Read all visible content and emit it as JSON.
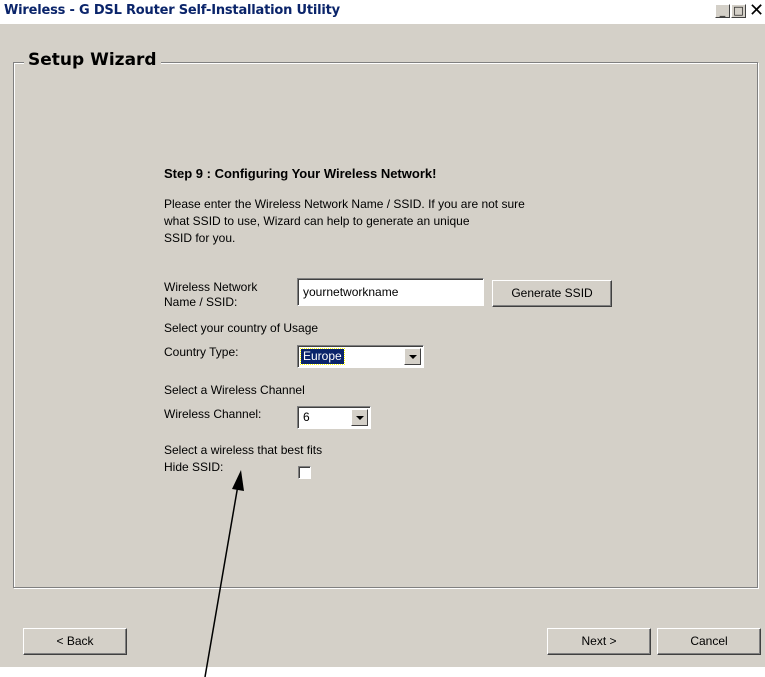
{
  "window": {
    "title": "Wireless - G DSL Router Self-Installation Utility",
    "minimize_glyph": "_",
    "maximize_glyph": "□",
    "close_glyph": "✕"
  },
  "wizard": {
    "group_title": "Setup Wizard",
    "step_heading": "Step 9 : Configuring Your Wireless Network!",
    "description_lines": [
      "Please enter the Wireless Network Name / SSID. If you are not sure",
      "what SSID to use, Wizard can help to generate an unique",
      "SSID for you."
    ],
    "ssid_label_lines": [
      "Wireless Network",
      "Name / SSID:"
    ],
    "ssid_value": "yournetworkname",
    "generate_button": "Generate SSID",
    "country_prompt": "Select your country of Usage",
    "country_label": "Country Type:",
    "country_value": "Europe",
    "channel_prompt": "Select a Wireless Channel",
    "channel_label": "Wireless Channel:",
    "channel_value": "6",
    "hide_prompt": "Select a wireless that best fits",
    "hide_label": "Hide SSID:",
    "hide_checked": false
  },
  "footer": {
    "back_button": "< Back",
    "next_button": "Next >",
    "cancel_button": "Cancel"
  },
  "colors": {
    "dialog_bg": "#d4d0c8",
    "title_text": "#0a246a",
    "selection": "#0a246a"
  }
}
